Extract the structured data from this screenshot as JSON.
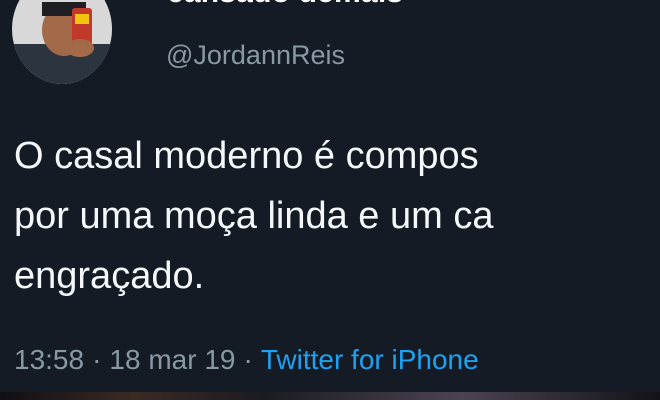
{
  "user": {
    "display_name": "cansado demais",
    "handle": "@JordannReis"
  },
  "tweet": {
    "lines": [
      "O casal moderno é compos",
      "por uma moça linda e um ca",
      "engraçado."
    ]
  },
  "meta": {
    "time": "13:58",
    "separator": "·",
    "date": "18 mar 19",
    "source": "Twitter for iPhone"
  },
  "colors": {
    "background": "#151b24",
    "text": "#f5f8fa",
    "secondary": "#8899a6",
    "link": "#1da1f2"
  }
}
